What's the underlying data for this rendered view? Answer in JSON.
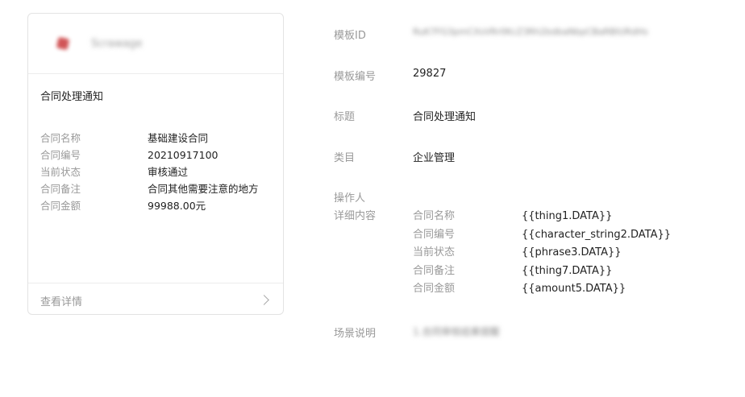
{
  "card": {
    "app_name": "Scrawage",
    "title": "合同处理通知",
    "fields": [
      {
        "label": "合同名称",
        "value": "基础建设合同"
      },
      {
        "label": "合同编号",
        "value": "20210917100"
      },
      {
        "label": "当前状态",
        "value": "审核通过"
      },
      {
        "label": "合同备注",
        "value": "合同其他需要注意的地方"
      },
      {
        "label": "合同金额",
        "value": "99988.00元"
      }
    ],
    "footer_label": "查看详情"
  },
  "info": {
    "template_id_label": "模板ID",
    "template_id_value": "RuK7FG3pmCXsVRr0KcZ3Rh2bdbaNbpCBaRBlURdHs",
    "template_no_label": "模板编号",
    "template_no_value": "29827",
    "title_label": "标题",
    "title_value": "合同处理通知",
    "category_label": "类目",
    "category_value": "企业管理",
    "operator_label": "操作人",
    "detail_label": "详细内容",
    "detail_rows": [
      {
        "label": "合同名称",
        "value": "{{thing1.DATA}}"
      },
      {
        "label": "合同编号",
        "value": "{{character_string2.DATA}}"
      },
      {
        "label": "当前状态",
        "value": "{{phrase3.DATA}}"
      },
      {
        "label": "合同备注",
        "value": "{{thing7.DATA}}"
      },
      {
        "label": "合同金额",
        "value": "{{amount5.DATA}}"
      }
    ],
    "scene_label": "场景说明",
    "scene_value": "1.合同审核结果提醒"
  }
}
